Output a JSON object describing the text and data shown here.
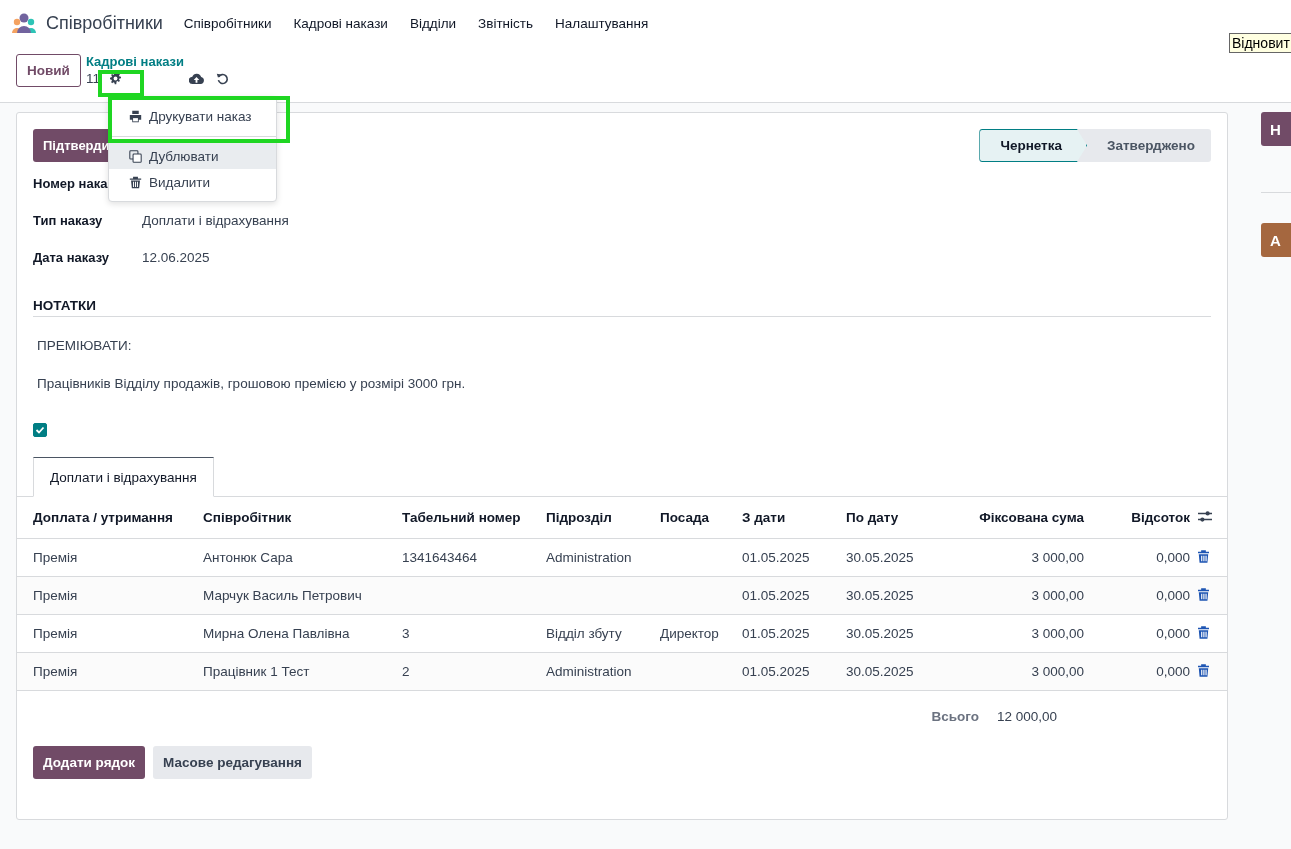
{
  "navbar": {
    "app_name": "Співробітники",
    "menu": [
      "Співробітники",
      "Кадрові накази",
      "Відділи",
      "Звітність",
      "Налаштування"
    ]
  },
  "control_panel": {
    "new_button": "Новий",
    "breadcrumb": "Кадрові накази",
    "record_counter": "11"
  },
  "tooltip": "Відновит",
  "action_menu": {
    "groups": [
      [
        {
          "kind": "print",
          "label": "Друкувати наказ",
          "hovered": false
        }
      ],
      [
        {
          "kind": "duplicate",
          "label": "Дублювати",
          "hovered": true
        },
        {
          "kind": "delete",
          "label": "Видалити",
          "hovered": false
        }
      ]
    ]
  },
  "form": {
    "confirm_button": "Підтверди",
    "statusbar": [
      {
        "label": "Чернетка",
        "selected": true
      },
      {
        "label": "Затверджено",
        "selected": false
      }
    ],
    "fields": [
      {
        "label": "Номер нака"
      },
      {
        "label": "Тип наказу",
        "value": "Доплати і відрахування"
      },
      {
        "label": "Дата наказу",
        "value": "12.06.2025"
      }
    ],
    "notes": {
      "title": "НОТАТКИ",
      "paragraphs": [
        "ПРЕМІЮВАТИ:",
        "Працівників Відділу продажів, грошовою премією у розмірі 3000 грн."
      ]
    },
    "checkbox": {
      "checked": true
    },
    "tabs": [
      {
        "label": "Доплати і відрахування",
        "selected": true
      }
    ],
    "table": {
      "columns": [
        "Доплата / утримання",
        "Співробітник",
        "Табельний номер",
        "Підрозділ",
        "Посада",
        "З дати",
        "По дату",
        "Фіксована сума",
        "Відсоток"
      ],
      "rows": [
        {
          "cells": [
            "Премія",
            "Антонюк Сара",
            "1341643464",
            "Administration",
            "",
            "01.05.2025",
            "30.05.2025",
            "3 000,00",
            "0,000"
          ]
        },
        {
          "cells": [
            "Премія",
            "Марчук Василь Петрович",
            "",
            "",
            "",
            "01.05.2025",
            "30.05.2025",
            "3 000,00",
            "0,000"
          ]
        },
        {
          "cells": [
            "Премія",
            "Мирна Олена Павлівна",
            "3",
            "Відділ збуту",
            "Директор",
            "01.05.2025",
            "30.05.2025",
            "3 000,00",
            "0,000"
          ]
        },
        {
          "cells": [
            "Премія",
            "Працівник 1 Тест",
            "2",
            "Administration",
            "",
            "01.05.2025",
            "30.05.2025",
            "3 000,00",
            "0,000"
          ]
        }
      ]
    },
    "total": {
      "label": "Всього",
      "value": "12 000,00"
    },
    "buttons": [
      {
        "kind": "primary",
        "label": "Додати рядок"
      },
      {
        "kind": "secondary",
        "label": "Масове редагування"
      }
    ]
  },
  "side_panel": {
    "buttons": [
      {
        "label": "Н",
        "color": "#714b67"
      },
      {
        "label": "А",
        "color": "#a5673f"
      }
    ]
  }
}
